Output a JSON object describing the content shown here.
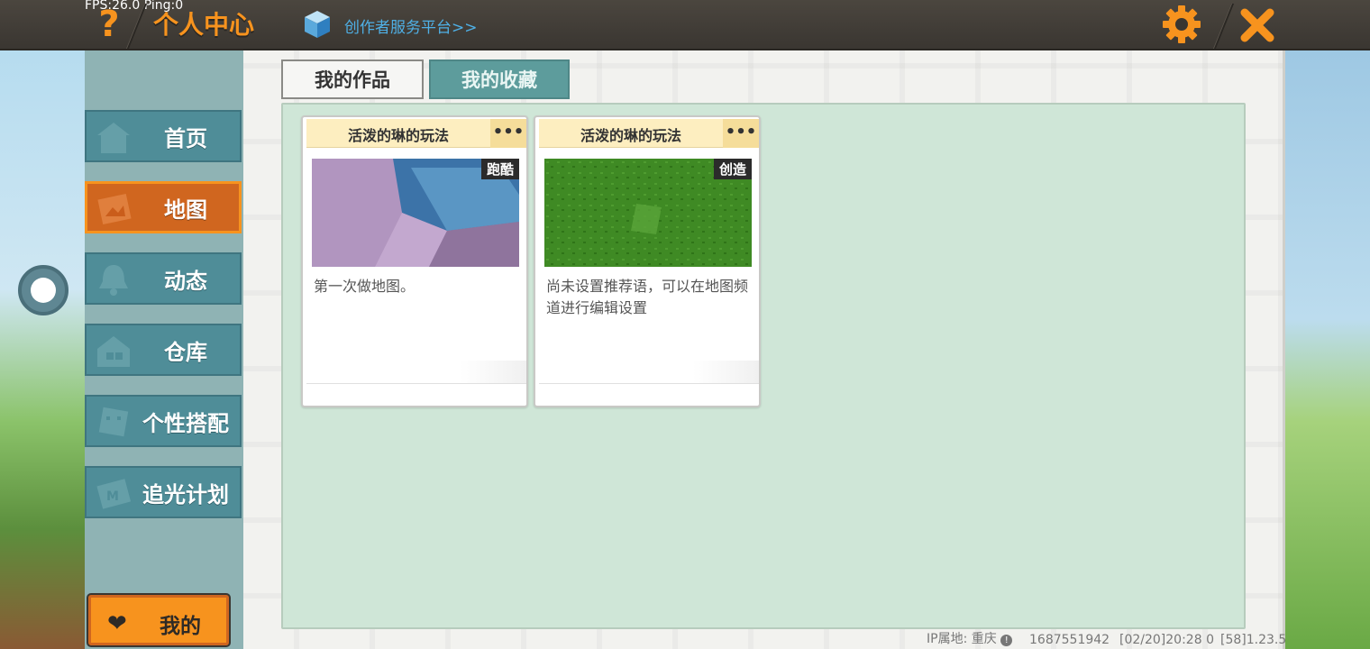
{
  "topbar": {
    "fps": "FPS:26.0  Ping:0",
    "title": "个人中心",
    "creator_link": "创作者服务平台>>"
  },
  "sidebar": {
    "items": [
      {
        "label": "首页",
        "icon": "house-icon"
      },
      {
        "label": "地图",
        "icon": "map-icon",
        "active": true
      },
      {
        "label": "动态",
        "icon": "bell-icon"
      },
      {
        "label": "仓库",
        "icon": "warehouse-icon"
      },
      {
        "label": "个性搭配",
        "icon": "avatar-icon"
      },
      {
        "label": "追光计划",
        "icon": "ticket-icon"
      }
    ],
    "mine_label": "我的"
  },
  "tabs": {
    "works": "我的作品",
    "favorites": "我的收藏"
  },
  "cards": [
    {
      "title": "活泼的琳的玩法",
      "more": "•••",
      "badge": "跑酷",
      "desc": "第一次做地图。"
    },
    {
      "title": "活泼的琳的玩法",
      "more": "•••",
      "badge": "创造",
      "desc": "尚未设置推荐语，可以在地图频道进行编辑设置"
    }
  ],
  "footer": {
    "ip": "IP属地: 重庆",
    "uid": "1687551942",
    "time": "[02/20]20:28 0",
    "version": "[58]1.23.5"
  },
  "colors": {
    "accent_orange": "#f7931e",
    "nav_teal": "#4f8d98",
    "content_green": "#cfe6d7",
    "card_header": "#fdeec0"
  }
}
